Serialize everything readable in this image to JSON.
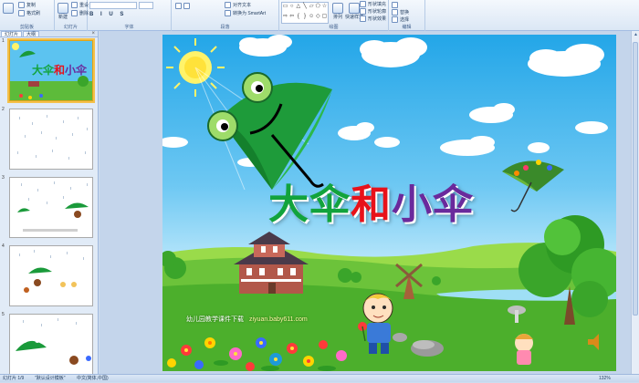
{
  "ribbon": {
    "groups": [
      "剪贴板",
      "幻灯片",
      "字体",
      "段落",
      "绘图",
      "编辑"
    ],
    "buttons": {
      "copy": "复制",
      "format_painter": "格式刷",
      "new_slide": "新建",
      "reset": "重设",
      "delete": "删除",
      "align_text": "对齐文本",
      "convert_smartart": "转换为 SmartArt",
      "shape_fill": "形状填充",
      "shape_outline": "形状轮廓",
      "shape_effects": "形状效果",
      "arrange": "排列",
      "quick_styles": "快速样式",
      "replace": "替换",
      "select": "选择"
    }
  },
  "left_pane": {
    "tabs": [
      "幻灯片",
      "大纲"
    ],
    "close_glyph": "×",
    "slide_numbers": [
      "1",
      "2",
      "3",
      "4",
      "5"
    ]
  },
  "slide": {
    "title_part1": "大伞",
    "title_part2": "和",
    "title_part3": "小伞",
    "credit": "幼儿园教学课件下载",
    "url": "ziyuan.baby611.com"
  },
  "status": {
    "slide_info": "幻灯片 1/9",
    "theme": "\"默认设计模板\"",
    "language": "中文(简体,中国)",
    "zoom": "132%"
  },
  "colors": {
    "title_green": "#12a33c",
    "title_red": "#e8121a",
    "title_purple": "#6a2a9c",
    "ribbon_bg": "#dbe7f5",
    "selection": "#f4c04a"
  }
}
